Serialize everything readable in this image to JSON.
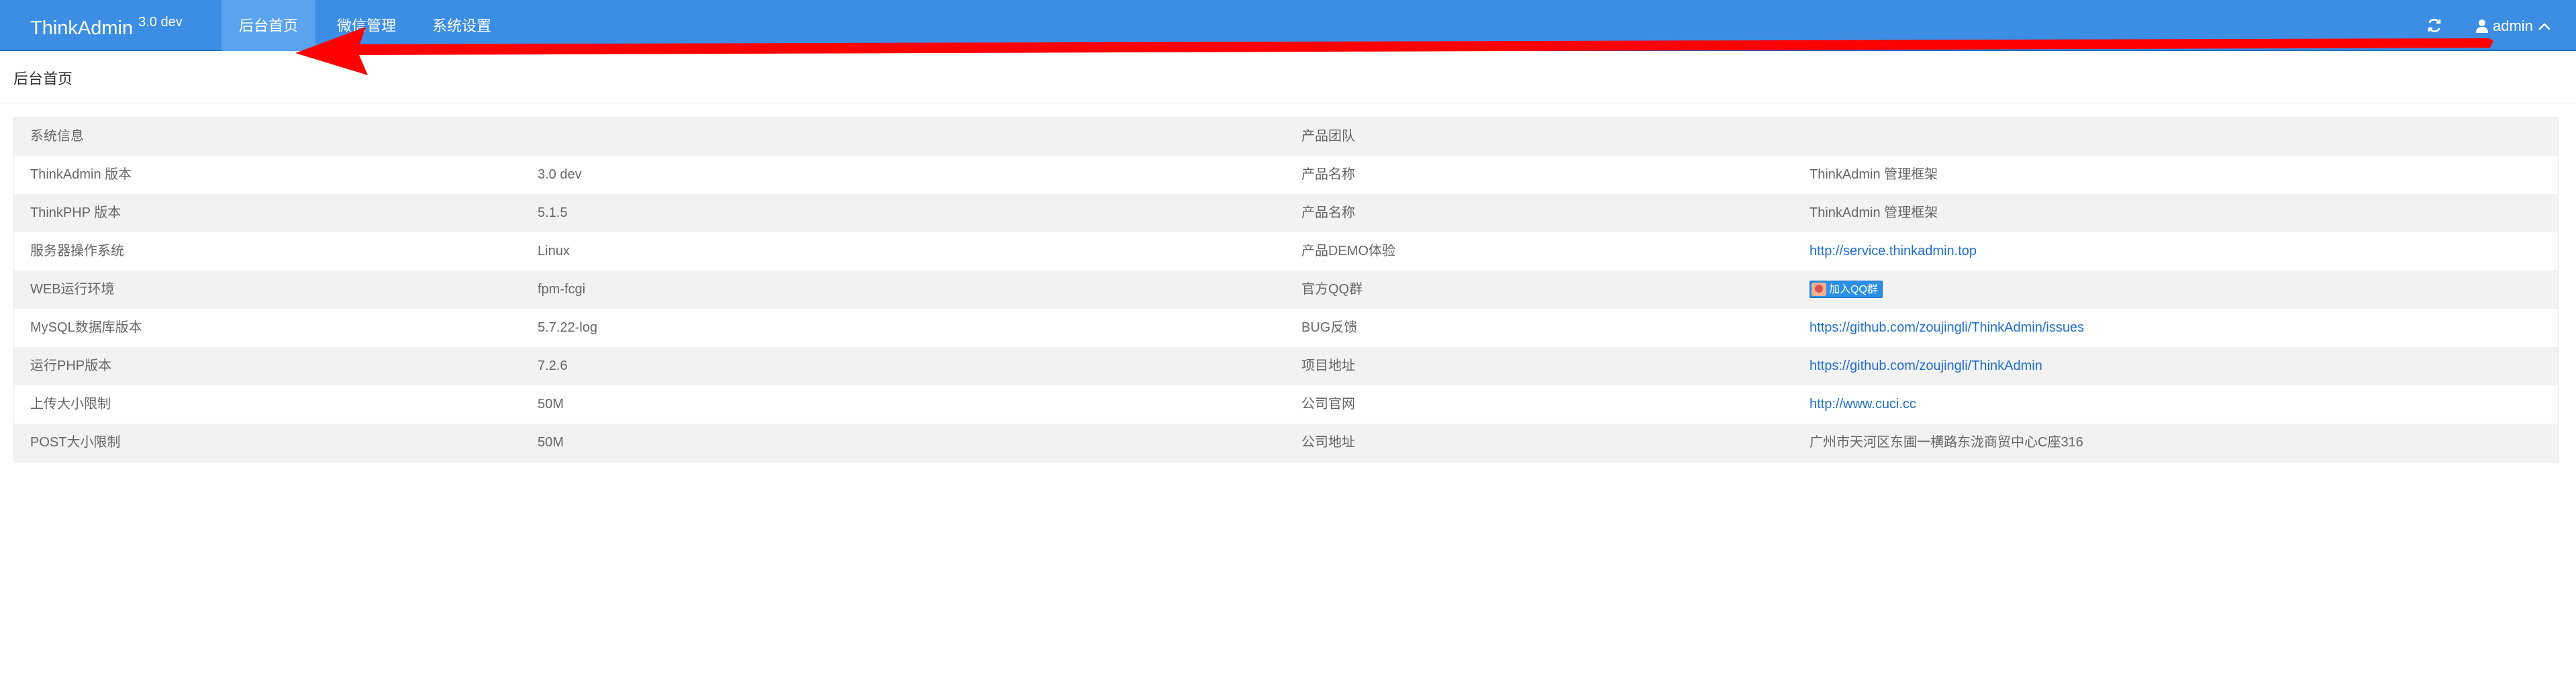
{
  "header": {
    "brand_name": "ThinkAdmin",
    "brand_version": "3.0 dev",
    "nav": [
      {
        "label": "后台首页",
        "active": true
      },
      {
        "label": "微信管理",
        "active": false
      },
      {
        "label": "系统设置",
        "active": false
      }
    ],
    "refresh_icon": "refresh-icon",
    "user_icon": "user-icon",
    "user_label": "admin",
    "user_chevron": "chevron-up-icon"
  },
  "page": {
    "title": "后台首页"
  },
  "info": {
    "rows": [
      {
        "c1": "系统信息",
        "c2": "",
        "c3": "产品团队",
        "c4": ""
      },
      {
        "c1": "ThinkAdmin 版本",
        "c2": "3.0 dev",
        "c3": "产品名称",
        "c4": "ThinkAdmin 管理框架"
      },
      {
        "c1": "ThinkPHP 版本",
        "c2": "5.1.5",
        "c3": "产品名称",
        "c4": "ThinkAdmin 管理框架"
      },
      {
        "c1": "服务器操作系统",
        "c2": "Linux",
        "c3": "产品DEMO体验",
        "c4": "http://service.thinkadmin.top"
      },
      {
        "c1": "WEB运行环境",
        "c2": "fpm-fcgi",
        "c3": "官方QQ群",
        "c4": "加入QQ群"
      },
      {
        "c1": "MySQL数据库版本",
        "c2": "5.7.22-log",
        "c3": "BUG反馈",
        "c4": "https://github.com/zoujingli/ThinkAdmin/issues"
      },
      {
        "c1": "运行PHP版本",
        "c2": "7.2.6",
        "c3": "项目地址",
        "c4": "https://github.com/zoujingli/ThinkAdmin"
      },
      {
        "c1": "上传大小限制",
        "c2": "50M",
        "c3": "公司官网",
        "c4": "http://www.cuci.cc"
      },
      {
        "c1": "POST大小限制",
        "c2": "50M",
        "c3": "公司地址",
        "c4": "广州市天河区东圃一横路东泷商贸中心C座316"
      }
    ]
  },
  "colors": {
    "topbar": "#3c8ee5",
    "active_tab": "#5aa3ee",
    "link": "#1e6ed6",
    "annotation_arrow": "#ff0000",
    "row_shade": "#f2f2f2"
  }
}
